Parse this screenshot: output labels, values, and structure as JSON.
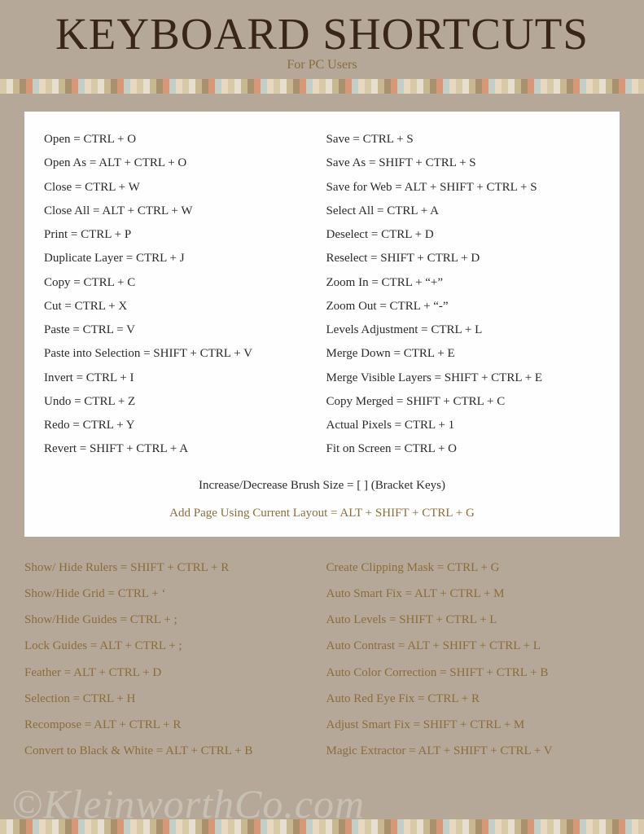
{
  "header": {
    "title": "KEYBOARD SHORTCUTS",
    "subtitle": "For PC Users"
  },
  "top": {
    "left": [
      "Open = CTRL + O",
      "Open As = ALT + CTRL + O",
      "Close = CTRL + W",
      "Close All = ALT + CTRL + W",
      "Print = CTRL + P",
      "Duplicate Layer = CTRL + J",
      "Copy = CTRL + C",
      "Cut = CTRL + X",
      "Paste = CTRL = V",
      "Paste into Selection = SHIFT + CTRL + V",
      "Invert = CTRL + I",
      "Undo = CTRL + Z",
      "Redo = CTRL + Y",
      "Revert = SHIFT + CTRL + A"
    ],
    "right": [
      "Save = CTRL + S",
      "Save As = SHIFT + CTRL + S",
      "Save for Web = ALT + SHIFT + CTRL + S",
      "Select All = CTRL + A",
      "Deselect = CTRL + D",
      "Reselect = SHIFT + CTRL + D",
      "Zoom In = CTRL +  “+”",
      "Zoom Out = CTRL +  “-”",
      "Levels Adjustment = CTRL + L",
      "Merge Down =  CTRL + E",
      "Merge Visible Layers = SHIFT + CTRL + E",
      "Copy Merged = SHIFT + CTRL + C",
      "Actual Pixels = CTRL + 1",
      "Fit on Screen = CTRL + O"
    ]
  },
  "center": {
    "line1": "Increase/Decrease Brush Size =  [    ]  (Bracket Keys)",
    "line2": "Add Page Using Current Layout = ALT + SHIFT + CTRL + G"
  },
  "bottom": {
    "left": [
      "Show/ Hide Rulers = SHIFT + CTRL + R",
      "Show/Hide Grid = CTRL +  ‘",
      "Show/Hide Guides = CTRL + ;",
      "Lock Guides = ALT + CTRL + ;",
      "Feather = ALT + CTRL + D",
      "Selection = CTRL + H",
      "Recompose = ALT + CTRL + R",
      "Convert to Black & White = ALT + CTRL + B"
    ],
    "right": [
      "Create Clipping Mask = CTRL + G",
      "Auto Smart Fix = ALT + CTRL + M",
      "Auto Levels = SHIFT + CTRL + L",
      "Auto Contrast = ALT + SHIFT + CTRL + L",
      "Auto Color Correction = SHIFT + CTRL + B",
      "Auto Red Eye Fix = CTRL + R",
      "Adjust Smart Fix = SHIFT + CTRL + M",
      "Magic Extractor = ALT + SHIFT + CTRL + V"
    ]
  },
  "watermark": "©KleinworthCo.com"
}
